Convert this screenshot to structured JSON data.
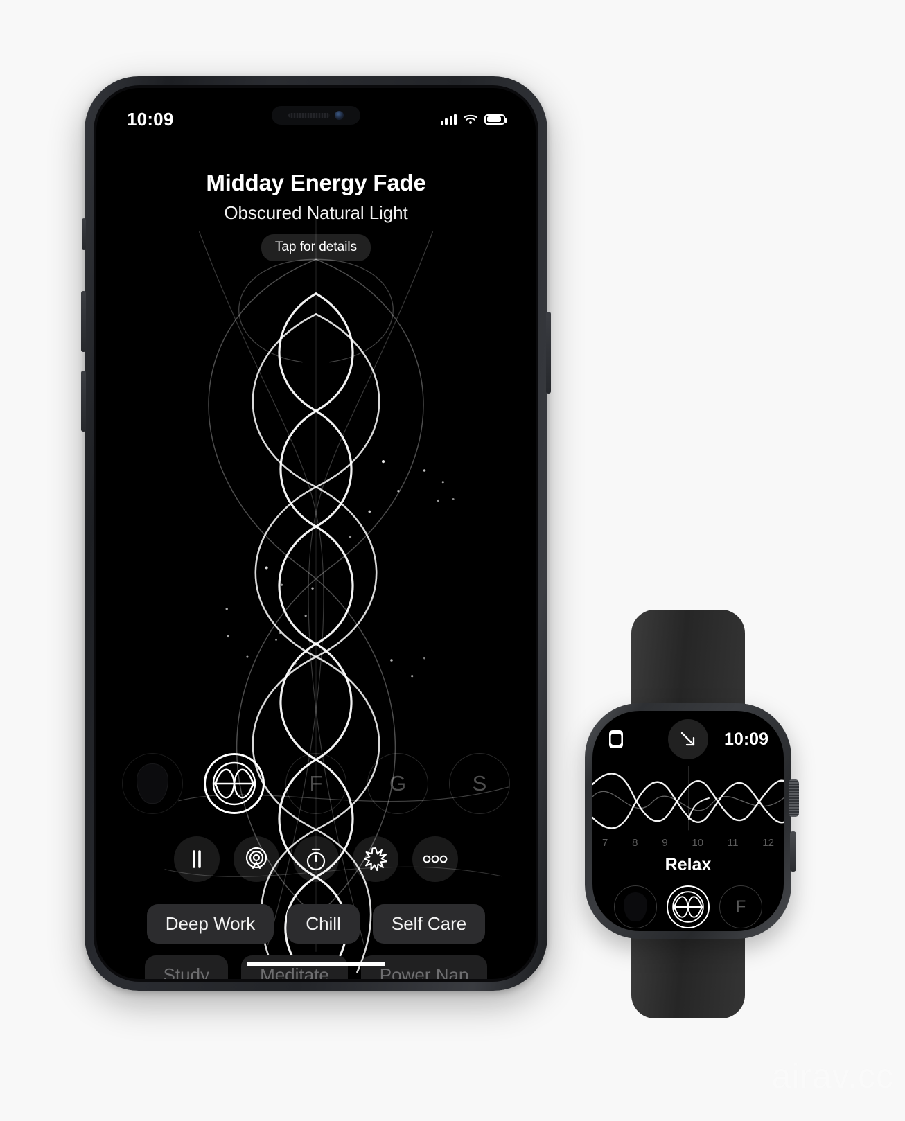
{
  "phone": {
    "status_bar": {
      "time": "10:09",
      "signal_icon": "cellular-bars-icon",
      "wifi_icon": "wifi-icon",
      "battery_icon": "battery-icon"
    },
    "header": {
      "title": "Midday Energy Fade",
      "subtitle": "Obscured Natural Light",
      "details_button": "Tap for details"
    },
    "selectors": [
      {
        "name": "profile",
        "label": "",
        "icon": "blob-silhouette-icon",
        "active": false
      },
      {
        "name": "wave",
        "label": "",
        "icon": "wave-circle-icon",
        "active": true
      },
      {
        "name": "f",
        "label": "F",
        "icon": "",
        "active": false
      },
      {
        "name": "g",
        "label": "G",
        "icon": "",
        "active": false
      },
      {
        "name": "s",
        "label": "S",
        "icon": "",
        "active": false
      }
    ],
    "controls": [
      {
        "name": "pause",
        "icon": "pause-icon"
      },
      {
        "name": "airplay",
        "icon": "broadcast-icon"
      },
      {
        "name": "timer",
        "icon": "stopwatch-icon"
      },
      {
        "name": "effects",
        "icon": "starburst-icon"
      },
      {
        "name": "more",
        "icon": "more-dots-icon"
      }
    ],
    "chips_row1": [
      "Deep Work",
      "Chill",
      "Self Care"
    ],
    "chips_row2": [
      "Study",
      "Meditate",
      "Power Nap"
    ]
  },
  "watch": {
    "status": {
      "watch_icon": "watch-app-icon",
      "arrow_icon": "arrow-down-right-icon",
      "time": "10:09"
    },
    "chart": {
      "ticks": [
        "7",
        "8",
        "9",
        "10",
        "11",
        "12"
      ]
    },
    "label": "Relax",
    "selectors": [
      {
        "name": "profile",
        "label": "",
        "icon": "blob-silhouette-icon",
        "active": false
      },
      {
        "name": "wave",
        "label": "",
        "icon": "wave-circle-icon",
        "active": true
      },
      {
        "name": "f",
        "label": "F",
        "icon": "",
        "active": false
      }
    ]
  },
  "watermark": "airav.cc",
  "colors": {
    "screen_bg": "#000000",
    "page_bg": "#f8f8f8",
    "accent": "#ffffff",
    "chip_bg": "#2c2c2e"
  },
  "chart_data": {
    "type": "line",
    "title": "",
    "x": [
      7,
      8,
      9,
      10,
      11,
      12
    ],
    "xlabel": "",
    "ylabel": "",
    "series": [
      {
        "name": "wave-a",
        "values": [
          0.5,
          -0.9,
          0.8,
          -0.7,
          0.85,
          -0.5
        ]
      },
      {
        "name": "wave-b",
        "values": [
          -0.6,
          0.85,
          -0.8,
          0.75,
          -0.8,
          0.55
        ]
      }
    ],
    "grid": false,
    "legend": "none"
  }
}
